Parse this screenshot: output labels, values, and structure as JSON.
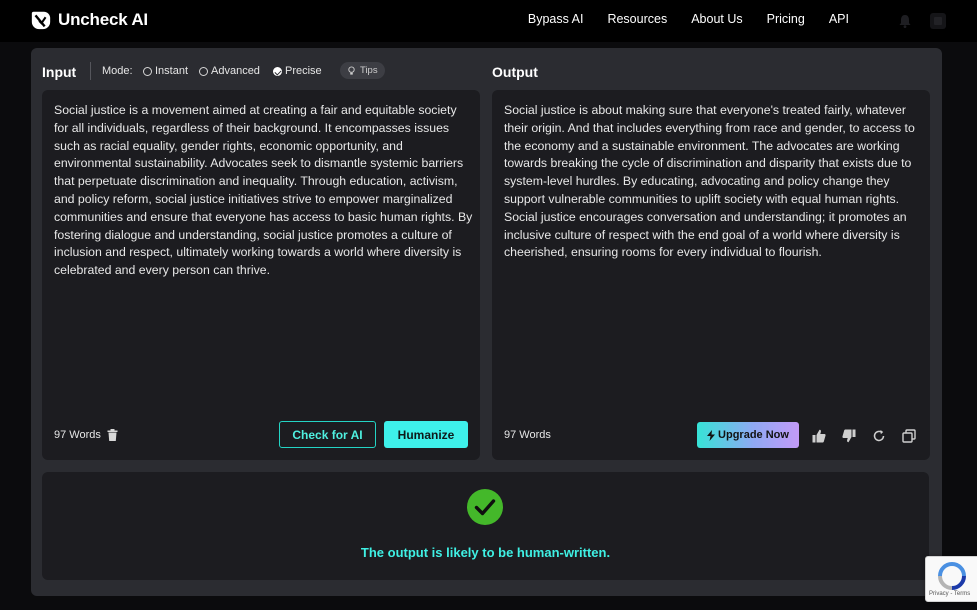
{
  "nav": {
    "brand": "Uncheck AI",
    "links": [
      "Bypass AI",
      "Resources",
      "About Us",
      "Pricing",
      "API"
    ]
  },
  "input": {
    "title": "Input",
    "mode_label": "Mode:",
    "modes": [
      {
        "label": "Instant",
        "selected": false
      },
      {
        "label": "Advanced",
        "selected": false
      },
      {
        "label": "Precise",
        "selected": true
      }
    ],
    "tips": "Tips",
    "text": "Social justice is a movement aimed at creating a fair and equitable society for all individuals, regardless of their background. It encompasses issues such as racial equality, gender rights, economic opportunity, and environmental sustainability. Advocates seek to dismantle systemic barriers that perpetuate discrimination and inequality. Through education, activism, and policy reform, social justice initiatives strive to empower marginalized communities and ensure that everyone has access to basic human rights. By fostering dialogue and understanding, social justice promotes a culture of inclusion and respect, ultimately working towards a world where diversity is celebrated and every person can thrive.",
    "word_count": "97 Words",
    "check_button": "Check for AI",
    "humanize_button": "Humanize"
  },
  "output": {
    "title": "Output",
    "text": "Social justice is about making sure that everyone's treated fairly, whatever their origin. And that includes everything from race and gender, to access to the economy and a sustainable environment. The advocates are working towards breaking the cycle of discrimination and disparity that exists due to system-level hurdles. By educating, advocating and policy change they support vulnerable communities to uplift society with equal human rights. Social justice encourages conversation and understanding; it promotes an inclusive culture of respect with the end goal of a world where diversity is cheerished, ensuring rooms for every individual to flourish.",
    "word_count": "97 Words",
    "upgrade_button": "Upgrade Now"
  },
  "result": {
    "message": "The output is likely to be human-written."
  },
  "recaptcha": {
    "text": "Privacy - Terms"
  },
  "colors": {
    "accent": "#3ef0ea",
    "success": "#44b82a",
    "panel": "#2b2c31",
    "box": "#1c1c20"
  }
}
